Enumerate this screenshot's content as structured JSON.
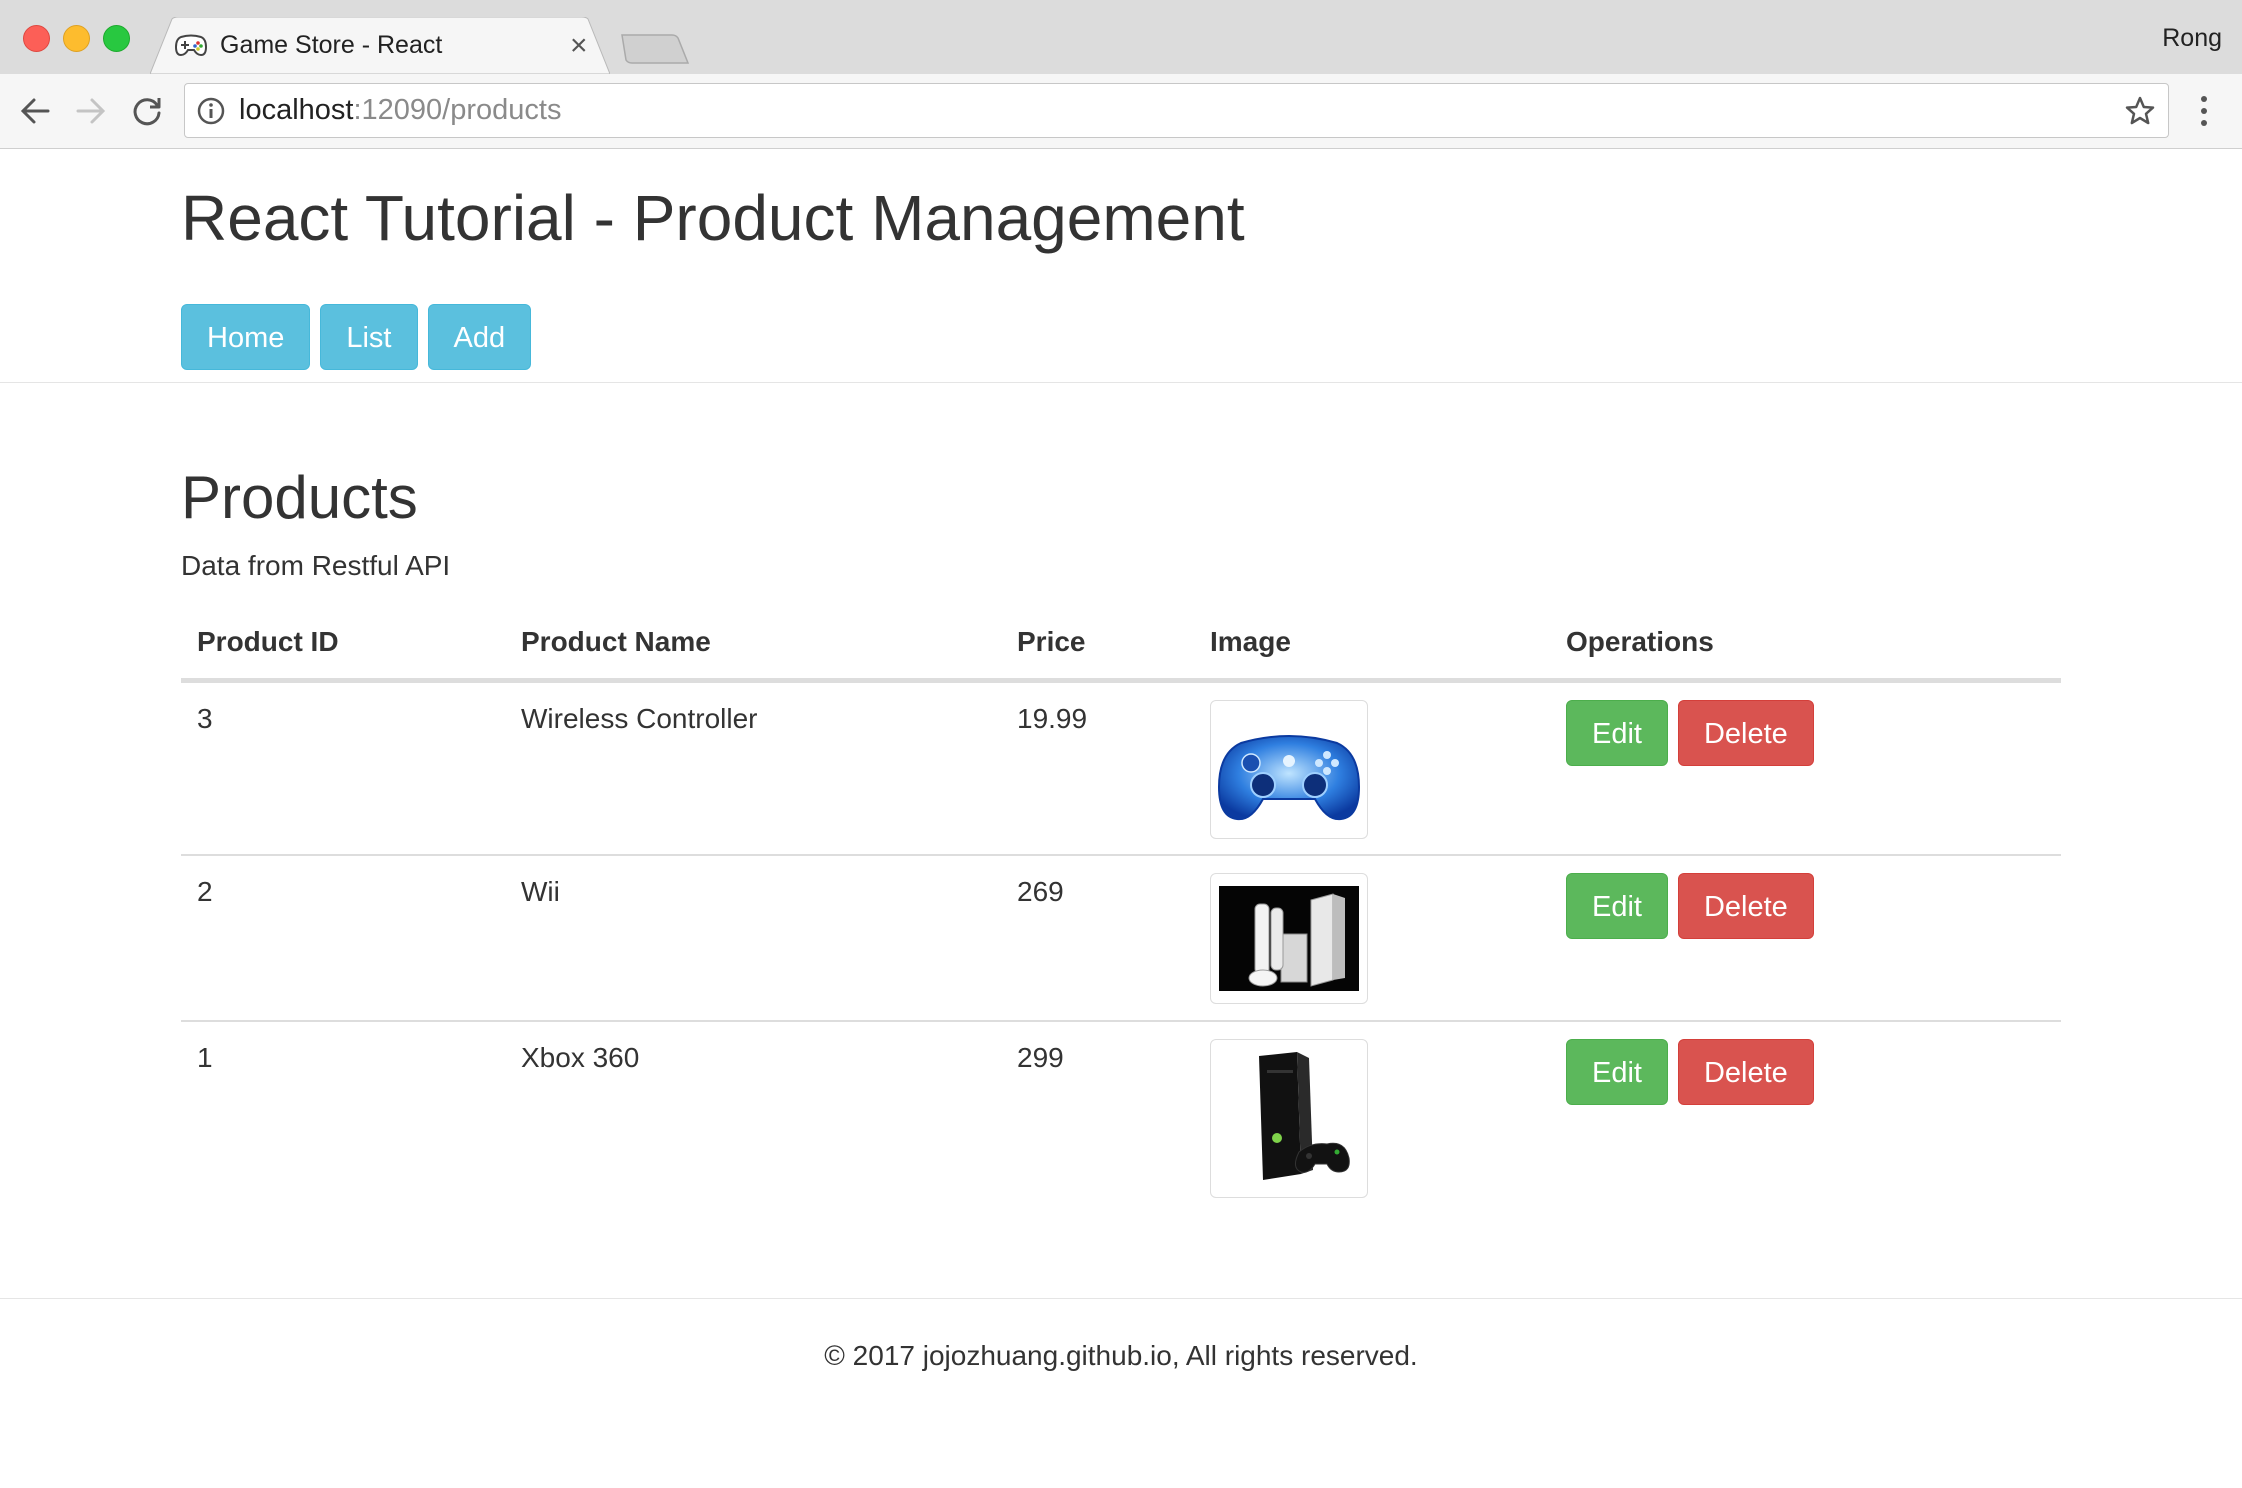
{
  "browser": {
    "tab_title": "Game Store - React",
    "profile_name": "Rong",
    "url_host": "localhost",
    "url_rest": ":12090/products"
  },
  "app": {
    "title": "React Tutorial - Product Management",
    "nav": [
      "Home",
      "List",
      "Add"
    ]
  },
  "products_section": {
    "title": "Products",
    "subtitle": "Data from Restful API",
    "columns": [
      "Product ID",
      "Product Name",
      "Price",
      "Image",
      "Operations"
    ],
    "rows": [
      {
        "id": "3",
        "name": "Wireless Controller",
        "price": "19.99",
        "image": "controller-image",
        "edit": "Edit",
        "delete": "Delete"
      },
      {
        "id": "2",
        "name": "Wii",
        "price": "269",
        "image": "wii-console-image",
        "edit": "Edit",
        "delete": "Delete"
      },
      {
        "id": "1",
        "name": "Xbox 360",
        "price": "299",
        "image": "xbox-console-image",
        "edit": "Edit",
        "delete": "Delete"
      }
    ]
  },
  "footer": {
    "text": "© 2017 jojozhuang.github.io, All rights reserved."
  },
  "colors": {
    "info": "#5bc0de",
    "success": "#5cb85c",
    "danger": "#d9534f"
  }
}
